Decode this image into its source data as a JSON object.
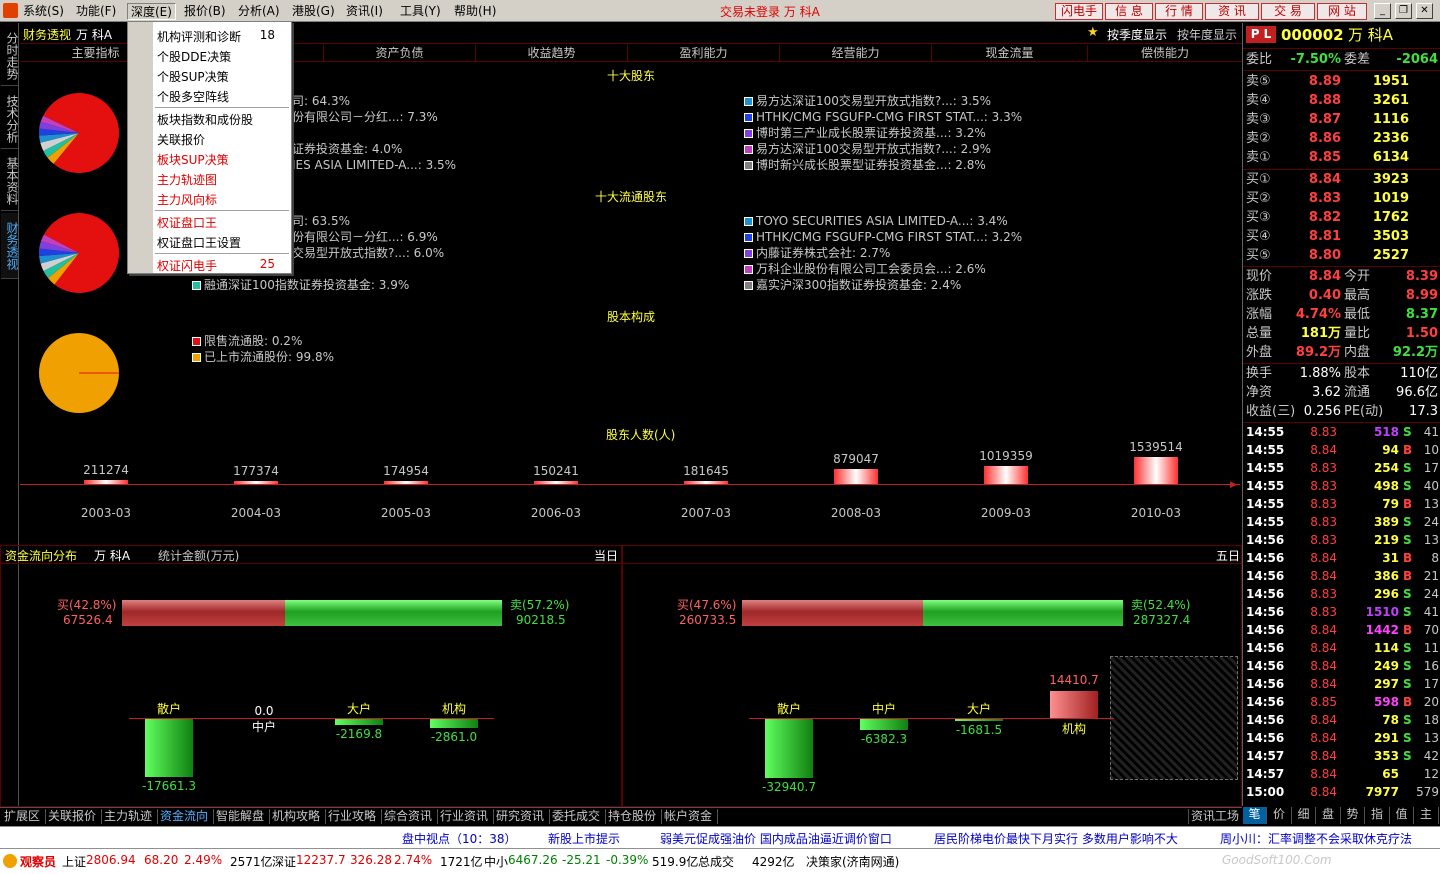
{
  "menubar": {
    "items": [
      "系统(S)",
      "功能(F)",
      "深度(E)",
      "报价(B)",
      "分析(A)",
      "港股(G)",
      "资讯(I)",
      "工具(Y)",
      "帮助(H)"
    ],
    "status": "交易未登录 万  科A",
    "buttons": [
      "闪电手",
      "信  息",
      "行  情",
      "资  讯",
      "交  易",
      "网  站"
    ]
  },
  "dropdown": {
    "items": [
      "机构评测和诊断",
      "个股DDE决策",
      "个股SUP决策",
      "个股多空阵线",
      "板块指数和成份股",
      "关联报价",
      "板块SUP决策",
      "主力轨迹图",
      "主力风向标",
      "权证盘口王",
      "权证盘口王设置",
      "权证闪电手"
    ],
    "keys": [
      "18",
      "25"
    ]
  },
  "vtabs": [
    "分时走势",
    "技术分析",
    "基本资料",
    "财务透视"
  ],
  "title": {
    "name": "财务透视",
    "stock": "万  科A",
    "star": "按季度显示",
    "year": "按年度显示"
  },
  "columns": [
    "主要指标",
    "",
    "资产负债",
    "收益趋势",
    "盈利能力",
    "经营能力",
    "现金流量",
    "偿债能力"
  ],
  "top10": {
    "title": "十大股东",
    "left": [
      "司: 64.3%",
      "份有限公司－分红...: 7.3%",
      "证券投资基金: 4.0%",
      "IES ASIA LIMITED-A...: 3.5%"
    ],
    "right": [
      "易方达深证100交易型开放式指数?...: 3.5%",
      "HTHK/CMG FSGUFP-CMG FIRST STAT...: 3.3%",
      "博时第三产业成长股票证券投资基...: 3.2%",
      "易方达深证100交易型开放式指数?...: 2.9%",
      "博时新兴成长股票型证券投资基金...: 2.8%"
    ],
    "right_colors": [
      "#1e90d0",
      "#2040e0",
      "#8040e0",
      "#c040c0",
      "#808080"
    ]
  },
  "float10": {
    "title": "十大流通股东",
    "left": [
      "司: 63.5%",
      "份有限公司－分红...: 6.9%",
      "交易型开放式指数?...: 6.0%",
      "",
      "融通深证100指数证券投资基金: 3.9%"
    ],
    "right": [
      "TOYO SECURITIES ASIA LIMITED-A...: 3.4%",
      "HTHK/CMG FSGUFP-CMG FIRST STAT...: 3.2%",
      "内藤证券株式会社: 2.7%",
      "万科企业股份有限公司工会委员会...: 2.6%",
      "嘉实沪深300指数证券投资基金: 2.4%"
    ],
    "right_colors": [
      "#1e90d0",
      "#2040e0",
      "#8040e0",
      "#c040c0",
      "#808080"
    ]
  },
  "structure": {
    "title": "股本构成",
    "items": [
      "限售流通股: 0.2%",
      "已上市流通股份: 99.8%"
    ]
  },
  "holders": {
    "title": "股东人数(人)",
    "years": [
      "2003-03",
      "2004-03",
      "2005-03",
      "2006-03",
      "2007-03",
      "2008-03",
      "2009-03",
      "2010-03"
    ],
    "values": [
      "211274",
      "177374",
      "174954",
      "150241",
      "181645",
      "879047",
      "1019359",
      "1539514"
    ]
  },
  "flow_left": {
    "title": "资金流向分布",
    "stock": "万  科A",
    "unit": "统计金额(万元)",
    "period": "当日",
    "buy": "买(42.8%)",
    "buy_val": "67526.4",
    "sell": "卖(57.2%)",
    "sell_val": "90218.5",
    "buy_frac": 0.428,
    "groups": [
      "散户",
      "中户",
      "大户",
      "机构"
    ],
    "values": [
      "-17661.3",
      "0.0",
      "-2169.8",
      "-2861.0"
    ]
  },
  "flow_right": {
    "period": "五日",
    "buy": "买(47.6%)",
    "buy_val": "260733.5",
    "sell": "卖(52.4%)",
    "sell_val": "287327.4",
    "buy_frac": 0.476,
    "groups": [
      "散户",
      "中户",
      "大户",
      "机构"
    ],
    "values": [
      "-32940.7",
      "-6382.3",
      "-1681.5",
      "14410.7"
    ]
  },
  "bottom_tabs": [
    "扩展区",
    "关联报价",
    "主力轨迹",
    "资金流向",
    "智能解盘",
    "机构攻略",
    "行业攻略",
    "综合资讯",
    "行业资讯",
    "研究资讯",
    "委托成交",
    "持仓股份",
    "帐户资金"
  ],
  "bottom_right": "资讯工场",
  "news": [
    "盘中视点（10：38）",
    "新股上市提示",
    "弱美元促成强油价  国内成品油逼近调价窗口",
    "居民阶梯电价最快下月实行  多数用户影响不大",
    "周小川：汇率调整不会采取休克疗法"
  ],
  "status": {
    "brand": "观察员",
    "sh": "上证",
    "sh_v": "2806.94",
    "sh_c": "68.20",
    "sh_p": "2.49%",
    "sh_a": "2571亿",
    "sz": "深证",
    "sz_v": "12237.7",
    "sz_c": "326.28",
    "sz_p": "2.74%",
    "sz_a": "1721亿",
    "zx": "中小",
    "zx_v": "6467.26",
    "zx_c": "-25.21",
    "zx_p": "-0.39%",
    "zx_a": "519.9亿",
    "total": "总成交",
    "total_v": "4292亿",
    "src": "决策家(济南网通)",
    "watermark": "GoodSoft100.Com"
  },
  "quote": {
    "pl": "P L",
    "code": "000002",
    "name": "万  科A",
    "wb_l": "委比",
    "wb": "-7.50%",
    "wc_l": "委差",
    "wc": "-2064",
    "sells": [
      [
        "卖⑤",
        "8.89",
        "1951"
      ],
      [
        "卖④",
        "8.88",
        "3261"
      ],
      [
        "卖③",
        "8.87",
        "1116"
      ],
      [
        "卖②",
        "8.86",
        "2336"
      ],
      [
        "卖①",
        "8.85",
        "6134"
      ]
    ],
    "buys": [
      [
        "买①",
        "8.84",
        "3923"
      ],
      [
        "买②",
        "8.83",
        "1019"
      ],
      [
        "买③",
        "8.82",
        "1762"
      ],
      [
        "买④",
        "8.81",
        "3503"
      ],
      [
        "买⑤",
        "8.80",
        "2527"
      ]
    ],
    "stats": [
      [
        "现价",
        "8.84",
        "今开",
        "8.39"
      ],
      [
        "涨跌",
        "0.40",
        "最高",
        "8.99"
      ],
      [
        "涨幅",
        "4.74%",
        "最低",
        "8.37"
      ],
      [
        "总量",
        "181万",
        "量比",
        "1.50"
      ],
      [
        "外盘",
        "89.2万",
        "内盘",
        "92.2万"
      ]
    ],
    "stats2": [
      [
        "换手",
        "1.88%",
        "股本",
        "110亿"
      ],
      [
        "净资",
        "3.62",
        "流通",
        "96.6亿"
      ],
      [
        "收益(三)",
        "0.256",
        "PE(动)",
        "17.3"
      ]
    ],
    "ticks": [
      [
        "14:55",
        "8.83",
        "518",
        "S",
        "41"
      ],
      [
        "14:55",
        "8.84",
        "94",
        "B",
        "10"
      ],
      [
        "14:55",
        "8.83",
        "254",
        "S",
        "17"
      ],
      [
        "14:55",
        "8.83",
        "498",
        "S",
        "40"
      ],
      [
        "14:55",
        "8.83",
        "79",
        "B",
        "13"
      ],
      [
        "14:55",
        "8.83",
        "389",
        "S",
        "24"
      ],
      [
        "14:56",
        "8.83",
        "219",
        "S",
        "13"
      ],
      [
        "14:56",
        "8.84",
        "31",
        "B",
        "8"
      ],
      [
        "14:56",
        "8.84",
        "386",
        "B",
        "21"
      ],
      [
        "14:56",
        "8.83",
        "296",
        "S",
        "24"
      ],
      [
        "14:56",
        "8.83",
        "1510",
        "S",
        "41"
      ],
      [
        "14:56",
        "8.84",
        "1442",
        "B",
        "70"
      ],
      [
        "14:56",
        "8.84",
        "114",
        "S",
        "11"
      ],
      [
        "14:56",
        "8.84",
        "249",
        "S",
        "16"
      ],
      [
        "14:56",
        "8.84",
        "297",
        "S",
        "17"
      ],
      [
        "14:56",
        "8.85",
        "598",
        "B",
        "20"
      ],
      [
        "14:56",
        "8.84",
        "78",
        "S",
        "18"
      ],
      [
        "14:56",
        "8.84",
        "291",
        "S",
        "13"
      ],
      [
        "14:57",
        "8.84",
        "353",
        "S",
        "42"
      ],
      [
        "14:57",
        "8.84",
        "65",
        "",
        "12"
      ],
      [
        "15:00",
        "8.84",
        "7977",
        "",
        "579"
      ]
    ],
    "tabs": [
      "笔",
      "价",
      "细",
      "盘",
      "势",
      "指",
      "值",
      "主"
    ]
  }
}
